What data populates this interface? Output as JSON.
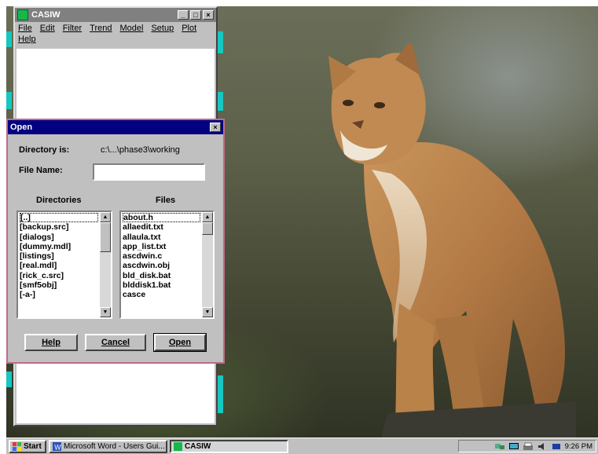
{
  "casiw_window": {
    "title": "CASIW",
    "menu": [
      "File",
      "Edit",
      "Filter",
      "Trend",
      "Model",
      "Setup",
      "Plot",
      "Help"
    ]
  },
  "open_dialog": {
    "title": "Open",
    "directory_label": "Directory is:",
    "directory_value": "c:\\...\\phase3\\working",
    "filename_label": "File Name:",
    "filename_value": "",
    "directories_label": "Directories",
    "files_label": "Files",
    "directories": [
      "[..]",
      "[backup.src]",
      "[dialogs]",
      "[dummy.mdl]",
      "[listings]",
      "[real.mdl]",
      "[rick_c.src]",
      "[smf5obj]",
      "[-a-]"
    ],
    "files": [
      "about.h",
      "allaedit.txt",
      "allaula.txt",
      "app_list.txt",
      "ascdwin.c",
      "ascdwin.obj",
      "bld_disk.bat",
      "blddisk1.bat",
      "casce"
    ],
    "buttons": {
      "help": "Help",
      "cancel": "Cancel",
      "open": "Open"
    }
  },
  "taskbar": {
    "start_label": "Start",
    "tasks": [
      "Microsoft Word - Users Gui...",
      "CASIW"
    ],
    "clock": "9:26 PM"
  },
  "colors": {
    "active_title": "#000080",
    "inactive_title": "#808080",
    "window_face": "#c0c0c0",
    "side_markers": "#17c7c0",
    "dialog_border": "#c06b87"
  }
}
